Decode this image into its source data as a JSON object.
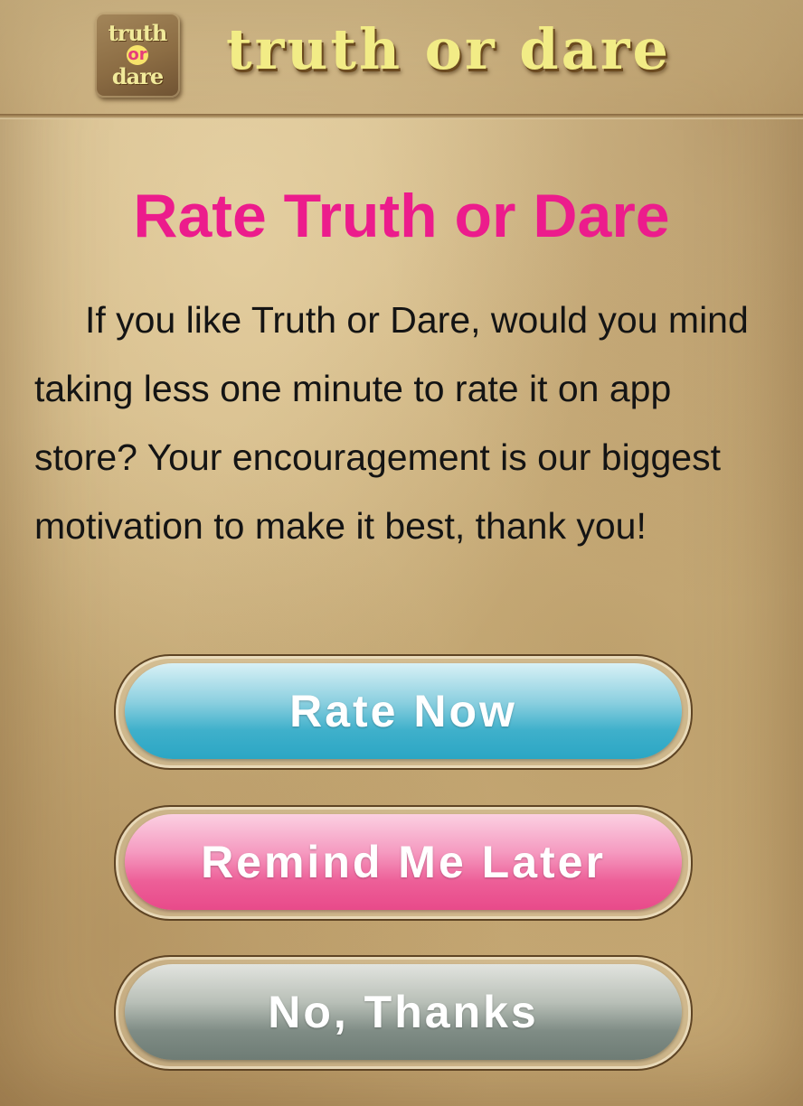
{
  "header": {
    "logo": {
      "line1": "truth",
      "line2": "or",
      "line3": "dare"
    },
    "app_title": "truth or dare"
  },
  "dialog": {
    "title": "Rate Truth or Dare",
    "message": "If you like Truth or Dare, would you mind taking less one minute  to rate it on app store? Your encouragement is our biggest motivation to make it best, thank you!"
  },
  "buttons": {
    "rate_now": "Rate Now",
    "remind_me_later": "Remind Me Later",
    "no_thanks": "No, Thanks"
  },
  "colors": {
    "title": "#ec1c8c",
    "rate_button": "#3fb0cb",
    "remind_button": "#ed5f98",
    "no_button": "#7f8c85",
    "app_title": "#f2ec86"
  }
}
